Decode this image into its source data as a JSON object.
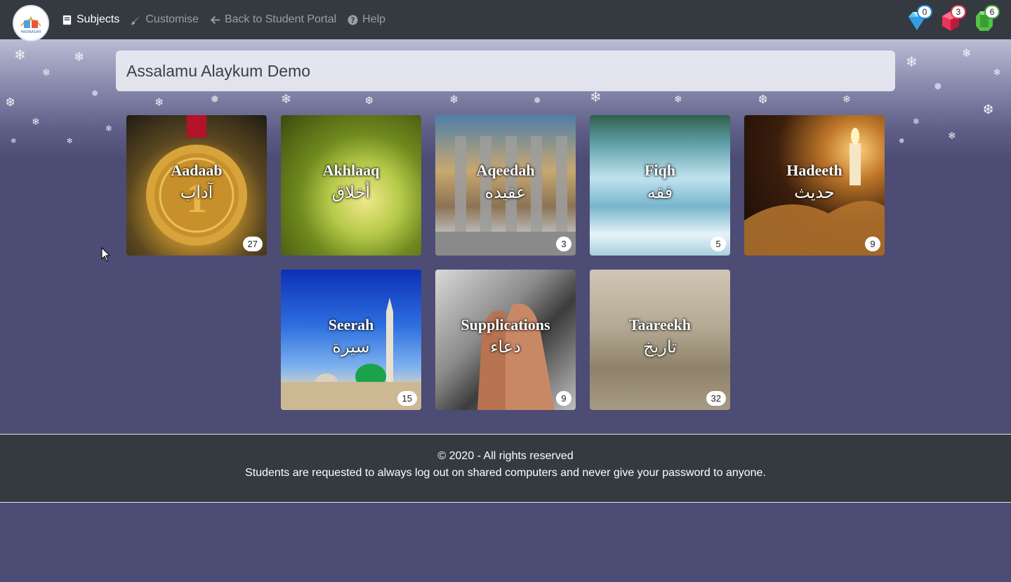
{
  "nav": {
    "logo_text": "MADRASAH",
    "items": [
      {
        "label": "Subjects",
        "icon": "book-icon",
        "active": true
      },
      {
        "label": "Customise",
        "icon": "brush-icon",
        "active": false
      },
      {
        "label": "Back to Student Portal",
        "icon": "arrow-left-icon",
        "active": false
      },
      {
        "label": "Help",
        "icon": "question-circle-icon",
        "active": false
      }
    ],
    "gems": [
      {
        "name": "diamond",
        "count": "0",
        "color": "#1e88e5"
      },
      {
        "name": "ruby",
        "count": "3",
        "color": "#e53950"
      },
      {
        "name": "emerald",
        "count": "6",
        "color": "#43a047"
      }
    ]
  },
  "greeting": "Assalamu Alaykum Demo",
  "subjects": [
    {
      "title": "Aadaab",
      "arabic": "آداب",
      "count": "27"
    },
    {
      "title": "Akhlaaq",
      "arabic": "أخلاق",
      "count": ""
    },
    {
      "title": "Aqeedah",
      "arabic": "عقيده",
      "count": "3"
    },
    {
      "title": "Fiqh",
      "arabic": "فقه",
      "count": "5"
    },
    {
      "title": "Hadeeth",
      "arabic": "حديث",
      "count": "9"
    },
    {
      "title": "Seerah",
      "arabic": "سيرة",
      "count": "15"
    },
    {
      "title": "Supplications",
      "arabic": "دعاء",
      "count": "9"
    },
    {
      "title": "Taareekh",
      "arabic": "تاريخ",
      "count": "32"
    }
  ],
  "footer": {
    "copyright": "© 2020 - All rights reserved",
    "notice": "Students are requested to always log out on shared computers and never give your password to anyone."
  }
}
